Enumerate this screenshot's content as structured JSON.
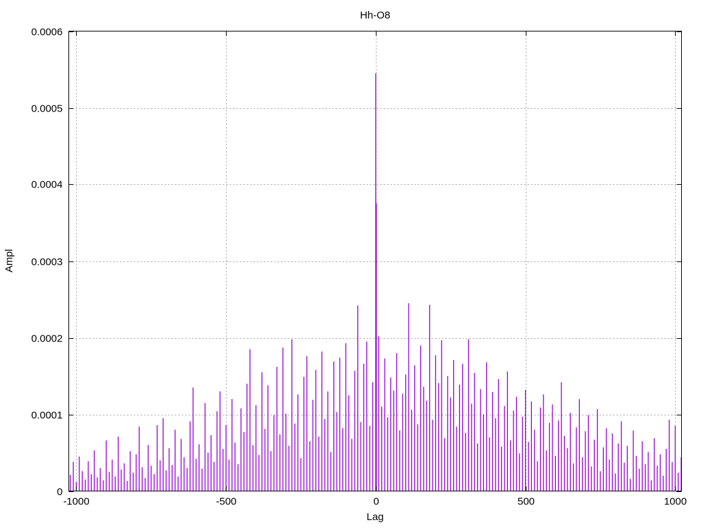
{
  "chart_data": {
    "type": "line",
    "style": "impulses",
    "title": "Hh-O8",
    "xlabel": "Lag",
    "ylabel": "Ampl",
    "xlim": [
      -1025,
      1021
    ],
    "ylim": [
      0,
      0.0006
    ],
    "grid": true,
    "legend": "none",
    "series_color": "#9400d3",
    "x_ticks": [
      {
        "value": -1000,
        "label": "-1000"
      },
      {
        "value": -500,
        "label": "-500"
      },
      {
        "value": 0,
        "label": "0"
      },
      {
        "value": 500,
        "label": "500"
      },
      {
        "value": 1000,
        "label": "1000"
      }
    ],
    "y_ticks": [
      {
        "value": 0,
        "label": "0"
      },
      {
        "value": 0.0001,
        "label": "0.0001"
      },
      {
        "value": 0.0002,
        "label": "0.0002"
      },
      {
        "value": 0.0003,
        "label": "0.0003"
      },
      {
        "value": 0.0004,
        "label": "0.0004"
      },
      {
        "value": 0.0005,
        "label": "0.0005"
      },
      {
        "value": 0.0006,
        "label": "0.0006"
      }
    ],
    "series": [
      {
        "name": "Ampl",
        "x_start": -1020,
        "x_step": 10,
        "values": [
          2.1e-05,
          3.8e-05,
          1.2e-05,
          4.5e-05,
          2.6e-05,
          1.5e-05,
          3.9e-05,
          2.2e-05,
          5.3e-05,
          1.8e-05,
          3e-05,
          1.4e-05,
          6.6e-05,
          2.5e-05,
          4.1e-05,
          1.9e-05,
          7.1e-05,
          2.8e-05,
          3.6e-05,
          1.3e-05,
          5.2e-05,
          2.4e-05,
          4.8e-05,
          8.4e-05,
          3.1e-05,
          1.7e-05,
          6e-05,
          3.3e-05,
          2.2e-05,
          8.6e-05,
          4e-05,
          9.5e-05,
          2.7e-05,
          5.6e-05,
          3.4e-05,
          8e-05,
          1.9e-05,
          6.8e-05,
          4.4e-05,
          3e-05,
          9.1e-05,
          0.000135,
          4.2e-05,
          6.1e-05,
          2.9e-05,
          0.000115,
          5e-05,
          7.3e-05,
          3.8e-05,
          0.000104,
          0.00013,
          5.5e-05,
          8.6e-05,
          4.1e-05,
          0.00012,
          6.3e-05,
          3.5e-05,
          0.000108,
          7.7e-05,
          0.00014,
          0.000185,
          6e-05,
          0.000112,
          4.7e-05,
          0.000155,
          8.1e-05,
          0.000138,
          5.2e-05,
          9.9e-05,
          0.000162,
          7.4e-05,
          0.000187,
          0.000101,
          5.9e-05,
          0.000198,
          8.8e-05,
          0.000126,
          4.3e-05,
          0.000149,
          0.000176,
          6.5e-05,
          0.000119,
          0.000158,
          7.1e-05,
          0.000182,
          9.4e-05,
          0.00013,
          5.1e-05,
          0.000169,
          0.000103,
          0.000174,
          8.2e-05,
          0.000193,
          0.000125,
          6.8e-05,
          0.000157,
          0.000242,
          9e-05,
          0.000166,
          0.000195,
          8.5e-05,
          0.000142,
          0.000545,
          0.000202,
          0.00011,
          0.000173,
          9.6e-05,
          0.000148,
          0.000131,
          0.00018,
          7.9e-05,
          0.000127,
          0.000152,
          0.000245,
          0.000106,
          0.000164,
          8.7e-05,
          0.00019,
          0.000136,
          0.000118,
          0.000243,
          9.3e-05,
          0.000177,
          0.000141,
          0.000197,
          6.9e-05,
          0.00015,
          0.000122,
          0.000171,
          8.4e-05,
          0.000139,
          0.000166,
          7.6e-05,
          0.000198,
          0.000114,
          0.000154,
          6.2e-05,
          0.000133,
          0.0001,
          0.000168,
          7e-05,
          0.000129,
          9.5e-05,
          0.000146,
          5.8e-05,
          0.000111,
          0.000156,
          6.6e-05,
          0.000105,
          0.000123,
          4.9e-05,
          9.7e-05,
          0.000132,
          6.4e-05,
          0.000117,
          8e-05,
          3.9e-05,
          0.000109,
          0.000126,
          5.3e-05,
          8.9e-05,
          0.000113,
          4.6e-05,
          9.2e-05,
          0.000142,
          7.2e-05,
          5.6e-05,
          0.000102,
          3.6e-05,
          8.3e-05,
          0.00012,
          4.4e-05,
          7.8e-05,
          9.9e-05,
          3.2e-05,
          6.7e-05,
          0.000107,
          2.6e-05,
          5.7e-05,
          8.2e-05,
          4.1e-05,
          7.5e-05,
          2.3e-05,
          6.2e-05,
          9.1e-05,
          3.7e-05,
          5.9e-05,
          1.6e-05,
          7.9e-05,
          4.6e-05,
          2.9e-05,
          6.5e-05,
          3.5e-05,
          5.1e-05,
          1.4e-05,
          6.9e-05,
          3.3e-05,
          4.8e-05,
          2e-05,
          5.5e-05,
          9.3e-05,
          3.8e-05,
          8.5e-05,
          2.4e-05,
          4.4e-05
        ],
        "extra_points": [
          [
            2,
            0.000375
          ]
        ]
      }
    ]
  }
}
